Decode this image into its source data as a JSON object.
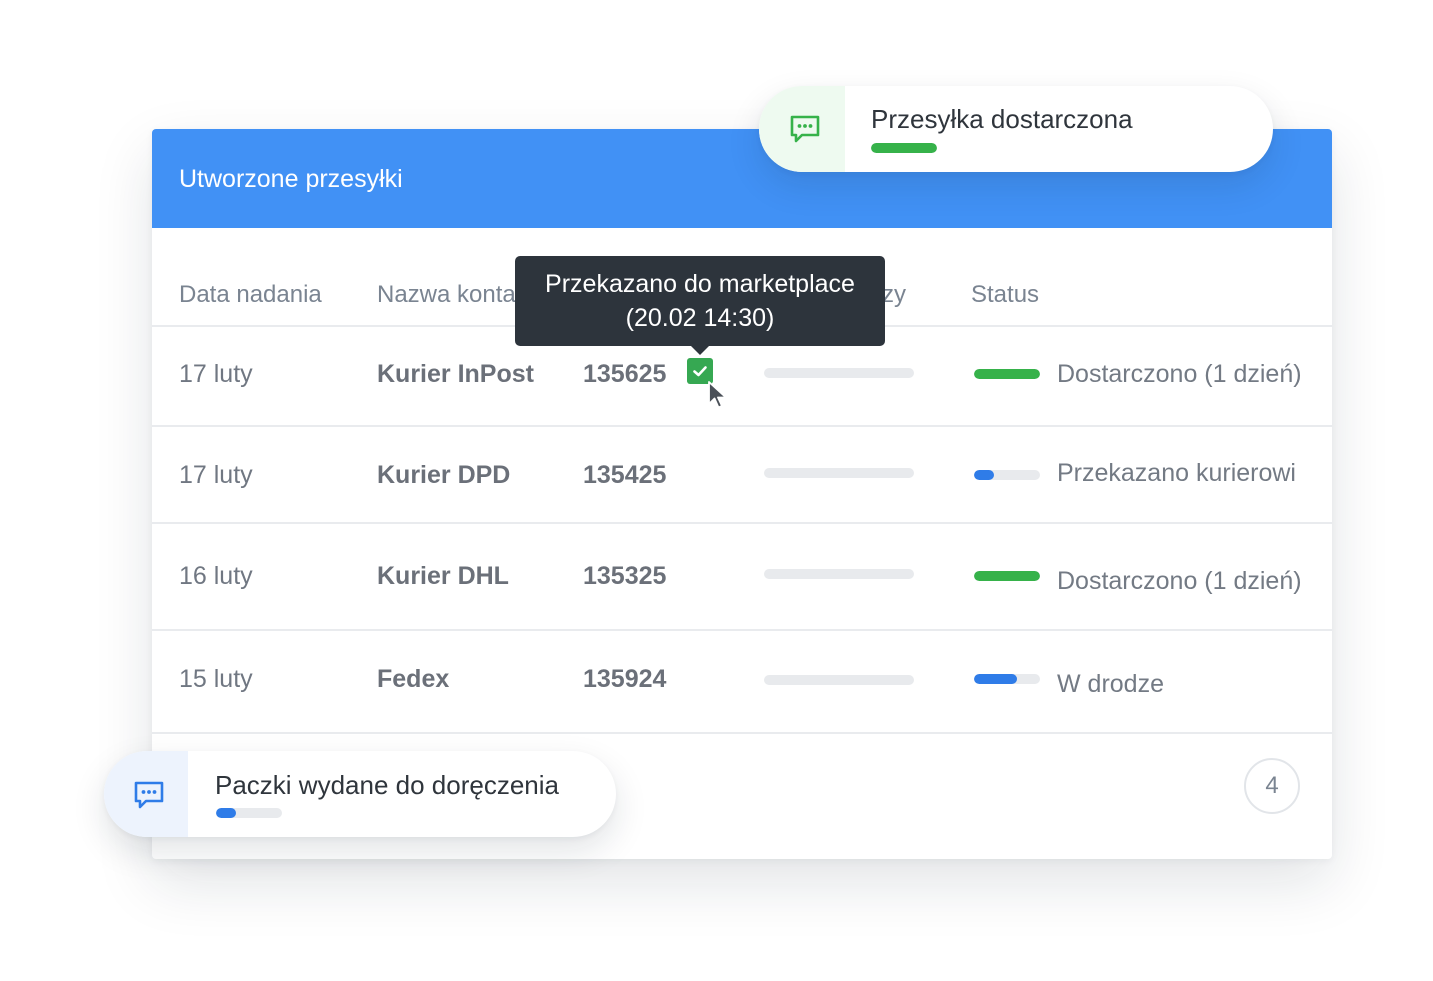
{
  "colors": {
    "header_bg": "#4191f5",
    "green": "#36b24a",
    "blue": "#2f7ce8",
    "tooltip_bg": "#2d343c"
  },
  "panel": {
    "title": "Utworzone przesyłki",
    "columns": {
      "date": "Data nadania",
      "name": "Nazwa konta",
      "col4": "zy",
      "status": "Status"
    },
    "rows": [
      {
        "date": "17 luty",
        "name": "Kurier InPost",
        "number": "135625",
        "status": "Dostarczono (1 dzień)",
        "progress": 1.0,
        "color": "green"
      },
      {
        "date": "17 luty",
        "name": "Kurier DPD",
        "number": "135425",
        "status": "Przekazano kurierowi",
        "progress": 0.3,
        "color": "blue"
      },
      {
        "date": "16 luty",
        "name": "Kurier DHL",
        "number": "135325",
        "status": "Dostarczono (1 dzień)",
        "progress": 1.0,
        "color": "green"
      },
      {
        "date": "15 luty",
        "name": "Fedex",
        "number": "135924",
        "status": "W drodze",
        "progress": 0.65,
        "color": "blue"
      }
    ],
    "page": "4"
  },
  "tooltip": {
    "line1": "Przekazano do marketplace",
    "line2": "(20.02 14:30)"
  },
  "toast_top": {
    "icon": "chat-icon",
    "text": "Przesyłka dostarczona",
    "progress": 1.0
  },
  "toast_bottom": {
    "icon": "chat-icon",
    "text": "Paczki wydane do doręczenia",
    "progress": 0.3
  }
}
